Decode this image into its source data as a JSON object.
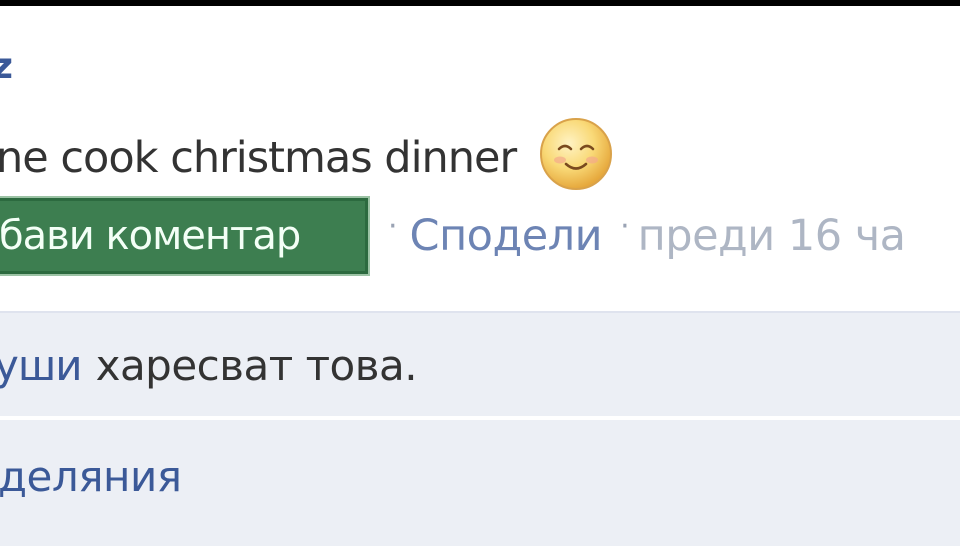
{
  "post": {
    "author_name": "z",
    "status_text": "ne cook christmas dinner",
    "emoji_icon": "smiling-face-icon"
  },
  "actions": {
    "comment_label": "бави коментар",
    "separator": "·",
    "share_label": "Сподели",
    "timestamp": "преди 16 ча"
  },
  "likes": {
    "names": "уши",
    "text": "харесват това."
  },
  "shares": {
    "label": "деляния"
  },
  "colors": {
    "link": "#3b5998",
    "comment_button_bg": "#3d7e50",
    "feedback_bg": "#eceff5"
  }
}
